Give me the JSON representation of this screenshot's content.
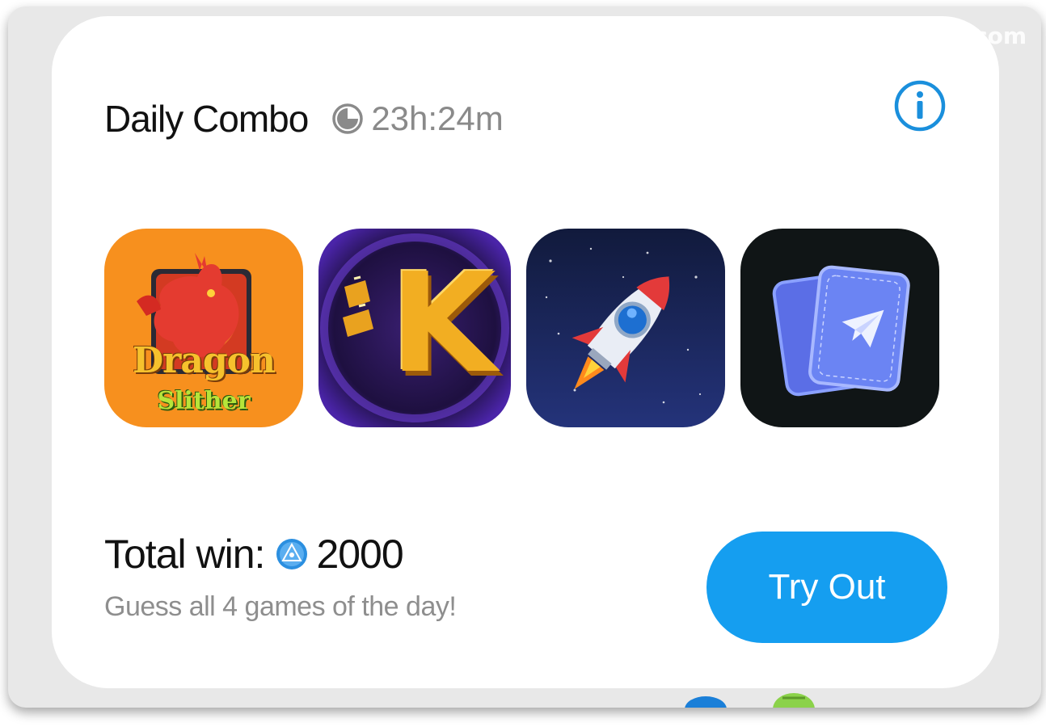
{
  "watermark": "com",
  "combo": {
    "title": "Daily Combo",
    "timer": "23h:24m",
    "clock_icon": "clock-icon",
    "info_icon": "info-icon"
  },
  "games": [
    {
      "name": "Dragon Slither",
      "line1": "Dragon",
      "line2": "Slither"
    },
    {
      "name": "K",
      "letter": "K"
    },
    {
      "name": "Rocket"
    },
    {
      "name": "Telegram Cards"
    }
  ],
  "total": {
    "label": "Total win:",
    "amount": "2000",
    "coin_icon": "coin-icon"
  },
  "subtitle": "Guess all 4 games of the day!",
  "button": {
    "label": "Try Out"
  },
  "colors": {
    "accent": "#159ef0",
    "title": "#111111",
    "muted": "#8e8e8e",
    "dragon_bg": "#f7901e",
    "k_bg": "#2a1656",
    "rocket_bg": "#1d2a63",
    "cards_bg": "#101516"
  }
}
